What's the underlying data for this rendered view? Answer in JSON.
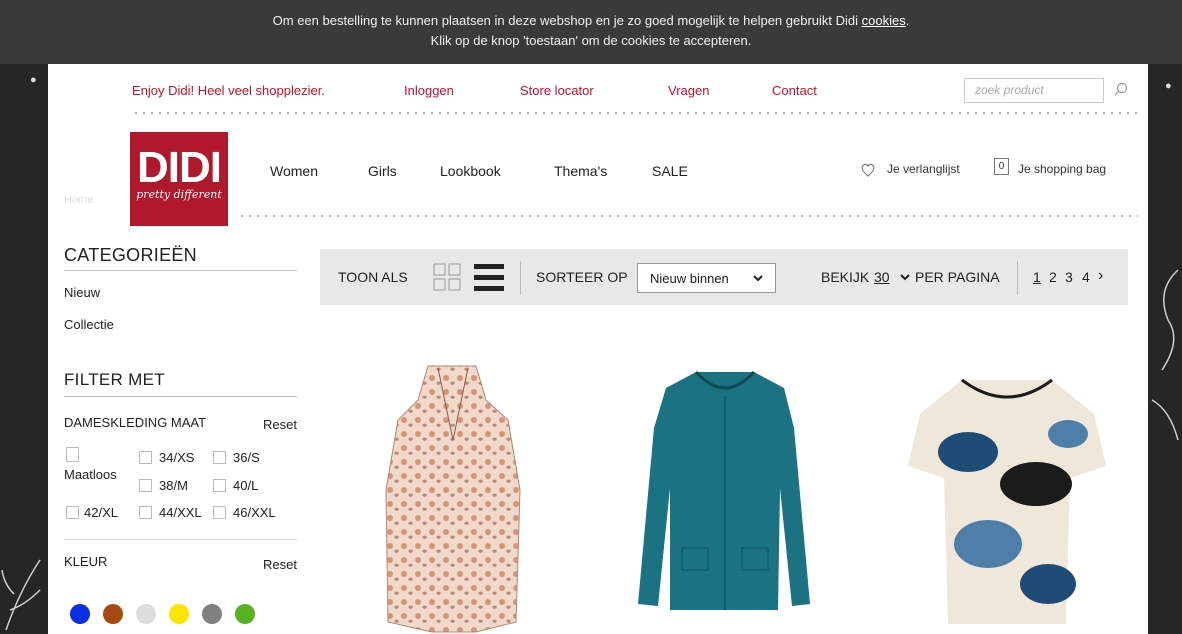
{
  "cookie_notice": {
    "line1_text": "Om een bestelling te kunnen plaatsen in deze webshop en je zo goed mogelijk te helpen gebruikt Didi ",
    "line1_link": "cookies",
    "line1_end": ".",
    "line2": "Klik op de knop 'toestaan' om de cookies te accepteren."
  },
  "topbar": {
    "tagline": "Enjoy Didi! Heel veel shopplezier.",
    "login": "Inloggen",
    "store_locator": "Store locator",
    "questions": "Vragen",
    "contact": "Contact",
    "search_placeholder": "zoek product"
  },
  "logo": {
    "main": "DIDI",
    "sub": "pretty different"
  },
  "ghost_label": "Home",
  "nav": [
    "Women",
    "Girls",
    "Lookbook",
    "Thema's",
    "SALE"
  ],
  "account": {
    "wishlist": "Je verlanglijst",
    "bag_count": "0",
    "bag": "Je shopping bag"
  },
  "sidebar": {
    "categories_title": "CATEGORIEËN",
    "categories": [
      "Nieuw",
      "Collectie"
    ],
    "filter_title": "FILTER MET",
    "size_title": "DAMESKLEDING MAAT",
    "reset": "Reset",
    "sizes": [
      "Maatloos",
      "34/XS",
      "36/S",
      "38/M",
      "40/L",
      "42/XL",
      "44/XXL",
      "46/XXL"
    ],
    "color_title": "KLEUR",
    "colors": [
      "#0a2ee6",
      "#a64a12",
      "#dddddd",
      "#ffe400",
      "#808080",
      "#56b21e"
    ]
  },
  "toolbar": {
    "view_label": "TOON ALS",
    "sort_label": "SORTEER OP",
    "sort_value": "Nieuw binnen",
    "show_label": "BEKIJK",
    "per_page": "30",
    "per_page_suffix": "PER PAGINA",
    "pages": [
      "1",
      "2",
      "3",
      "4"
    ],
    "next": "›"
  },
  "products": [
    {
      "name": "paisley-sleeveless-blouse",
      "colors": [
        "#f2d8c8",
        "#c98469",
        "#8b5a4a"
      ]
    },
    {
      "name": "teal-cardigan",
      "colors": [
        "#1b7283",
        "#155c6a"
      ]
    },
    {
      "name": "floral-print-tshirt",
      "colors": [
        "#efe7da",
        "#1f4b77",
        "#1b1b1b"
      ]
    }
  ]
}
